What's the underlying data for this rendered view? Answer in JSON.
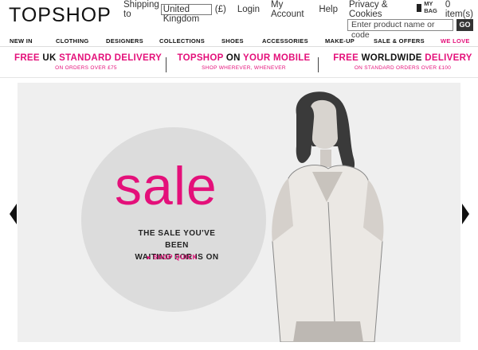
{
  "brand": {
    "logo": "TOPSHOP"
  },
  "topnav": {
    "shipping_label": "Shipping to",
    "country": "United Kingdom",
    "currency": "(£)",
    "login": "Login",
    "my_account": "My Account",
    "help": "Help",
    "privacy": "Privacy & Cookies",
    "bag_label": "MY BAG",
    "bag_count": "0 item(s)"
  },
  "search": {
    "placeholder": "Enter product name or code",
    "go_label": "GO"
  },
  "categories": [
    {
      "label": "NEW IN"
    },
    {
      "label": "CLOTHING"
    },
    {
      "label": "DESIGNERS"
    },
    {
      "label": "COLLECTIONS"
    },
    {
      "label": "SHOES"
    },
    {
      "label": "ACCESSORIES"
    },
    {
      "label": "MAKE-UP"
    },
    {
      "label": "SALE & OFFERS"
    },
    {
      "label": "WE LOVE"
    }
  ],
  "promos": [
    {
      "title_a": "FREE ",
      "title_b": "UK",
      "title_c": " STANDARD DELIVERY",
      "sub": "ON ORDERS OVER £75"
    },
    {
      "title_a": "TOPSHOP ",
      "title_b": "ON",
      "title_c": " YOUR MOBILE",
      "sub": "SHOP WHEREVER, WHENEVER"
    },
    {
      "title_a": "FREE ",
      "title_b": "WORLDWIDE",
      "title_c": " DELIVERY",
      "sub": "ON STANDARD ORDERS OVER £100"
    }
  ],
  "hero": {
    "headline": "sale",
    "tagline_1": "THE SALE YOU'VE BEEN",
    "tagline_2": "WAITING FOR IS ON",
    "cta": "▸ SHOP QUICK"
  },
  "colors": {
    "accent": "#e4107a",
    "hero_bg": "#efefef",
    "circle": "#dcdcdc"
  }
}
